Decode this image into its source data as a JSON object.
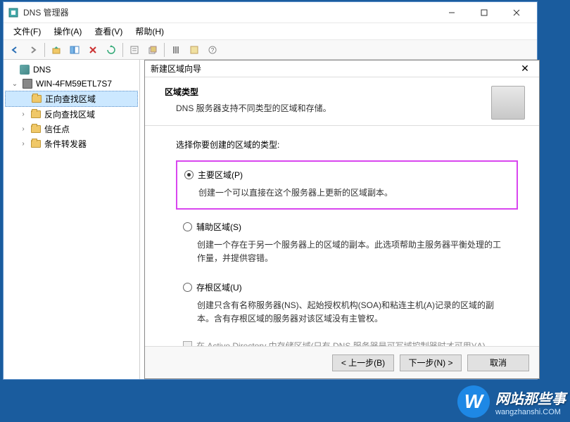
{
  "window": {
    "title": "DNS 管理器"
  },
  "menubar": {
    "file": "文件(F)",
    "action": "操作(A)",
    "view": "查看(V)",
    "help": "帮助(H)"
  },
  "tree": {
    "root": "DNS",
    "server": "WIN-4FM59ETL7S7",
    "forward": "正向查找区域",
    "reverse": "反向查找区域",
    "trust": "信任点",
    "cond": "条件转发器"
  },
  "wizard": {
    "title": "新建区域向导",
    "heading": "区域类型",
    "subheading": "DNS 服务器支持不同类型的区域和存储。",
    "prompt": "选择你要创建的区域的类型:",
    "opt1": {
      "label": "主要区域(P)",
      "desc": "创建一个可以直接在这个服务器上更新的区域副本。"
    },
    "opt2": {
      "label": "辅助区域(S)",
      "desc": "创建一个存在于另一个服务器上的区域的副本。此选项帮助主服务器平衡处理的工作量，并提供容错。"
    },
    "opt3": {
      "label": "存根区域(U)",
      "desc": "创建只含有名称服务器(NS)、起始授权机构(SOA)和粘连主机(A)记录的区域的副本。含有存根区域的服务器对该区域没有主管权。"
    },
    "adstore": "在 Active Directory 中存储区域(只有 DNS 服务器是可写域控制器时才可用)(A)",
    "back": "< 上一步(B)",
    "next": "下一步(N) >",
    "cancel": "取消"
  },
  "watermark": {
    "glyph": "W",
    "main": "网站那些事",
    "sub": "wangzhanshi.COM"
  }
}
